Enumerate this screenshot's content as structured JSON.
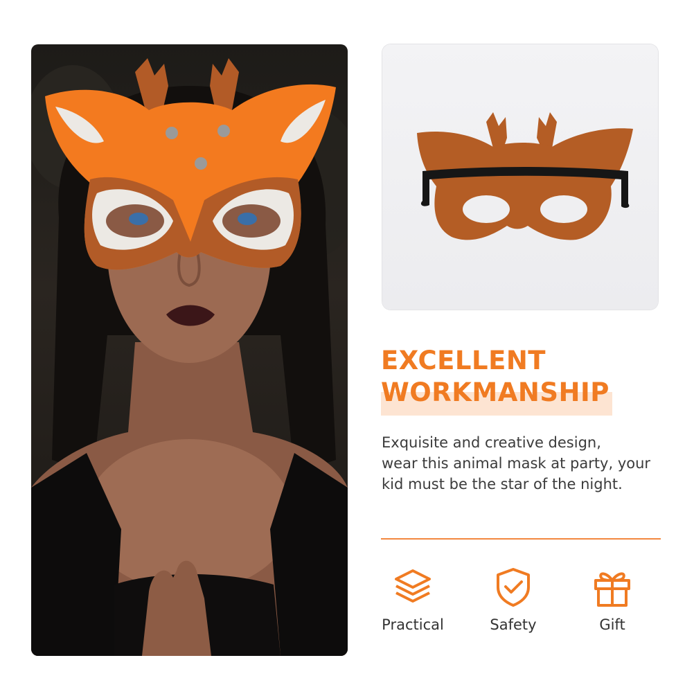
{
  "headline": {
    "line1": "EXCELLENT",
    "line2": "WORKMANSHIP"
  },
  "description": {
    "line1": "Exquisite and creative design,",
    "line2": "wear this animal mask at party, your",
    "line3": "kid must be the star of the night."
  },
  "features": [
    {
      "label": "Practical",
      "icon": "layers-icon"
    },
    {
      "label": "Safety",
      "icon": "shield-check-icon"
    },
    {
      "label": "Gift",
      "icon": "gift-icon"
    }
  ],
  "colors": {
    "accent": "#f07b22",
    "highlight": "#fde4d2",
    "mask_orange": "#f37a1f",
    "mask_brown": "#b25b27",
    "mask_white": "#ece9e4"
  }
}
